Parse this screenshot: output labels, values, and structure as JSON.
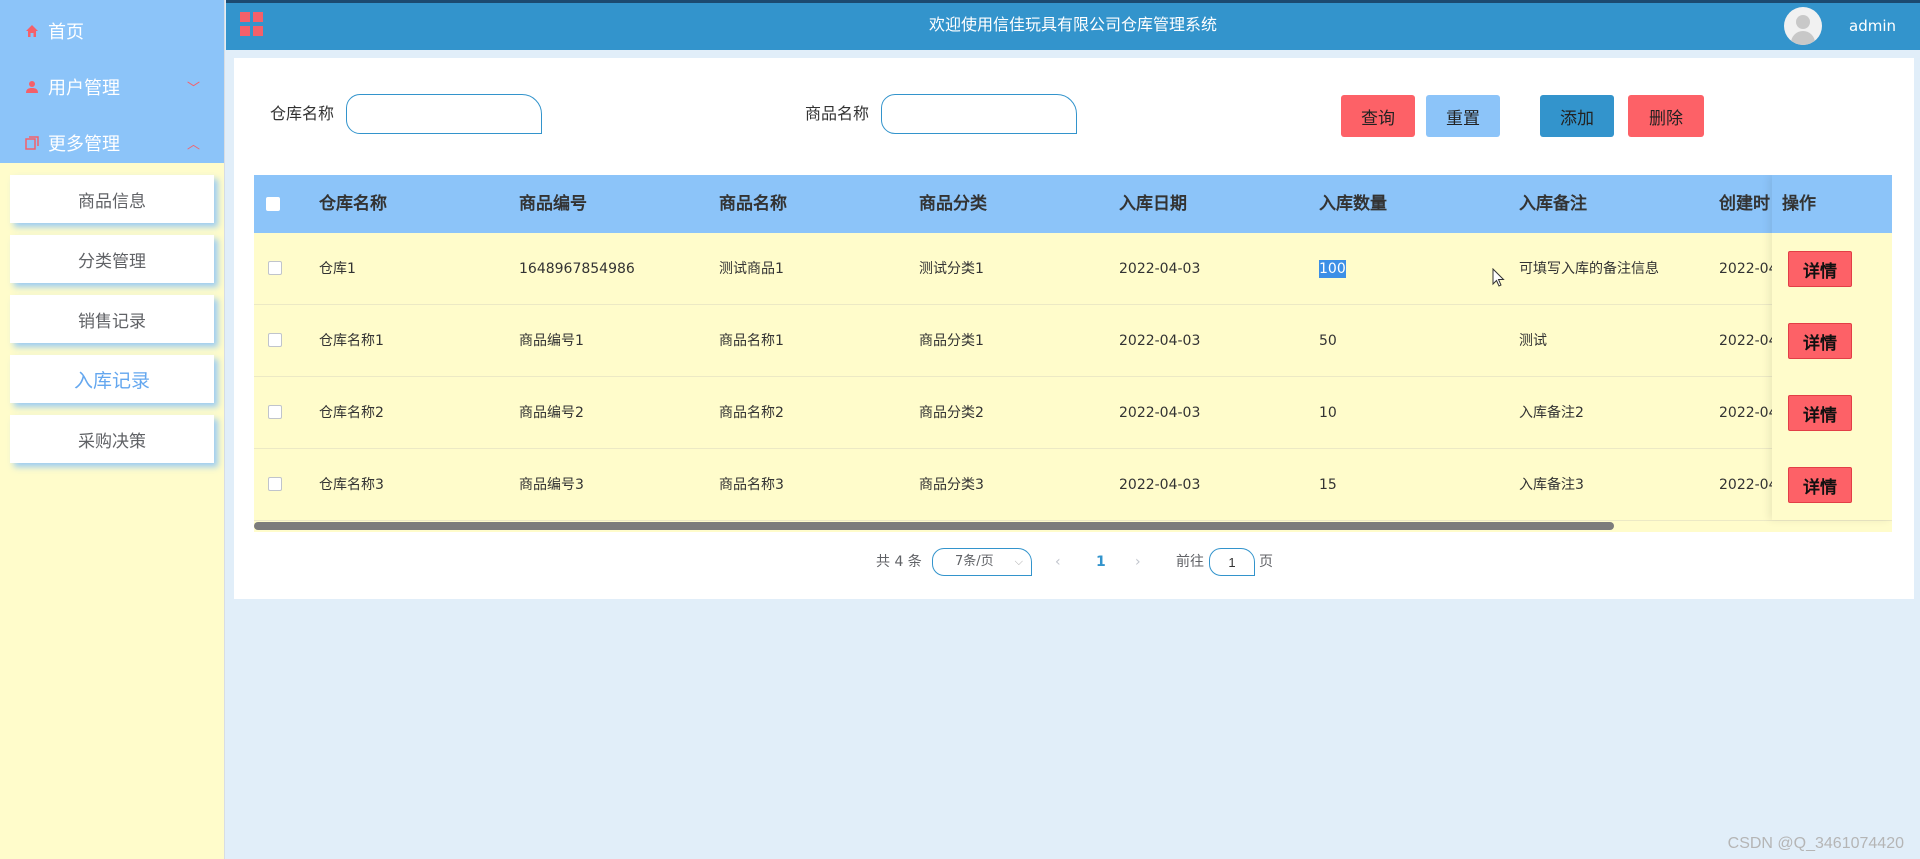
{
  "sidebar": {
    "top_items": [
      {
        "label": "首页",
        "icon": "home-icon"
      },
      {
        "label": "用户管理",
        "icon": "user-icon",
        "chevron": "﹀"
      },
      {
        "label": "更多管理",
        "icon": "copy-icon",
        "chevron": "︿"
      }
    ],
    "sub_items": [
      {
        "label": "商品信息"
      },
      {
        "label": "分类管理"
      },
      {
        "label": "销售记录"
      },
      {
        "label": "入库记录",
        "active": true
      },
      {
        "label": "采购决策"
      }
    ]
  },
  "header": {
    "title": "欢迎使用信佳玩具有限公司仓库管理系统",
    "username": "admin"
  },
  "search": {
    "warehouse_label": "仓库名称",
    "warehouse_value": "",
    "product_label": "商品名称",
    "product_value": ""
  },
  "buttons": {
    "query": "查询",
    "reset": "重置",
    "add": "添加",
    "delete": "删除"
  },
  "table": {
    "headers": {
      "warehouse": "仓库名称",
      "code": "商品编号",
      "name": "商品名称",
      "category": "商品分类",
      "date": "入库日期",
      "qty": "入库数量",
      "remark": "入库备注",
      "created": "创建时",
      "actions": "操作"
    },
    "rows": [
      {
        "warehouse": "仓库1",
        "code": "1648967854986",
        "name": "测试商品1",
        "category": "测试分类1",
        "date": "2022-04-03",
        "qty": "100",
        "remark": "可填写入库的备注信息",
        "created": "2022-04-",
        "action": "详情"
      },
      {
        "warehouse": "仓库名称1",
        "code": "商品编号1",
        "name": "商品名称1",
        "category": "商品分类1",
        "date": "2022-04-03",
        "qty": "50",
        "remark": "测试",
        "created": "2022-04-",
        "action": "详情"
      },
      {
        "warehouse": "仓库名称2",
        "code": "商品编号2",
        "name": "商品名称2",
        "category": "商品分类2",
        "date": "2022-04-03",
        "qty": "10",
        "remark": "入库备注2",
        "created": "2022-04-",
        "action": "详情"
      },
      {
        "warehouse": "仓库名称3",
        "code": "商品编号3",
        "name": "商品名称3",
        "category": "商品分类3",
        "date": "2022-04-03",
        "qty": "15",
        "remark": "入库备注3",
        "created": "2022-04-",
        "action": "详情"
      }
    ]
  },
  "pagination": {
    "total": "共 4 条",
    "page_size": "7条/页",
    "prev": "‹",
    "current": "1",
    "next": "›",
    "goto_label": "前往",
    "goto_value": "1",
    "goto_suffix": "页"
  },
  "watermark": "CSDN @Q_3461074420",
  "colors": {
    "sidebar_menu": "#8cc4f9",
    "sidebar_bg": "#fffccb",
    "topbar": "#3394cc",
    "danger": "#fd6167",
    "page_bg": "#e1eef9"
  }
}
